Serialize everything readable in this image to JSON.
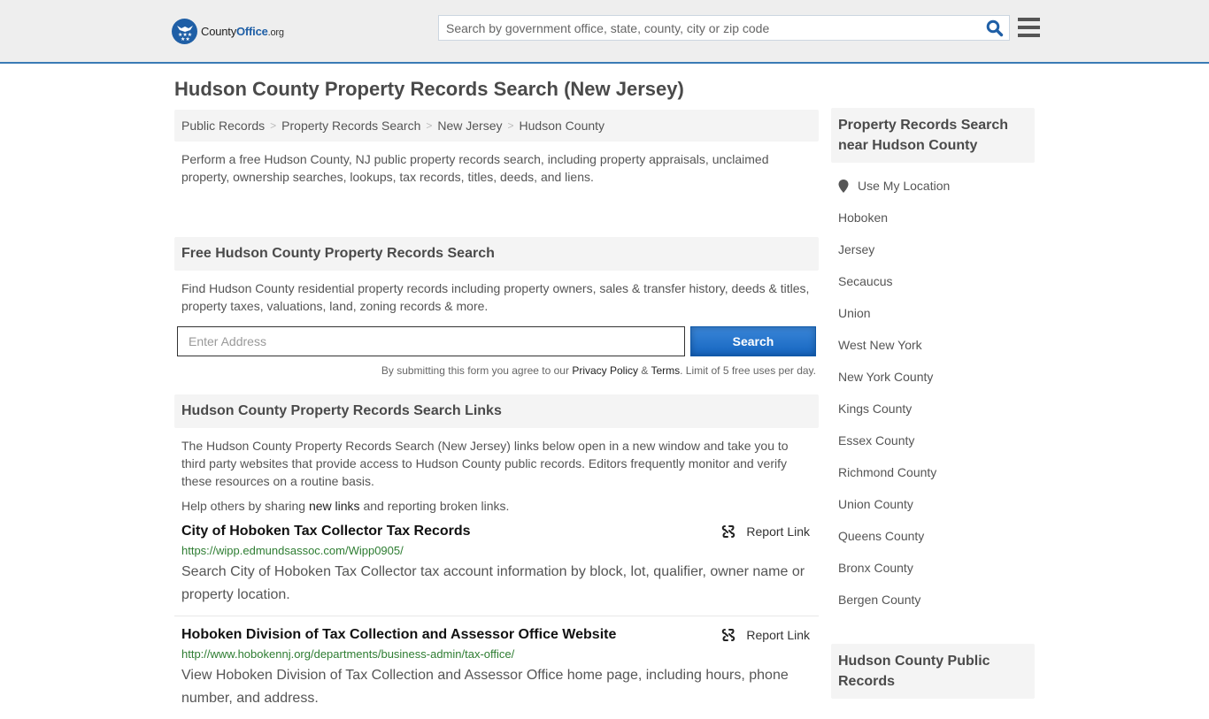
{
  "header": {
    "logo": {
      "name_part1": "County",
      "name_part2": "Office",
      "name_part3": ".org"
    },
    "search": {
      "placeholder": "Search by government office, state, county, city or zip code",
      "value": ""
    },
    "icons": {
      "search": "search-icon",
      "menu": "hamburger-menu-icon"
    }
  },
  "page": {
    "title": "Hudson County Property Records Search (New Jersey)",
    "breadcrumb": [
      {
        "label": "Public Records"
      },
      {
        "label": "Property Records Search"
      },
      {
        "label": "New Jersey"
      },
      {
        "label": "Hudson County"
      }
    ],
    "breadcrumb_separator": ">",
    "intro": "Perform a free Hudson County, NJ public property records search, including property appraisals, unclaimed property, ownership searches, lookups, tax records, titles, deeds, and liens."
  },
  "free_search": {
    "heading": "Free Hudson County Property Records Search",
    "description": "Find Hudson County residential property records including property owners, sales & transfer history, deeds & titles, property taxes, valuations, land, zoning records & more.",
    "address_input": {
      "placeholder": "Enter Address",
      "value": ""
    },
    "search_button": "Search",
    "terms": {
      "prefix": "By submitting this form you agree to our ",
      "privacy_label": "Privacy Policy",
      "amp": " & ",
      "terms_label": "Terms",
      "suffix": ". Limit of 5 free uses per day."
    }
  },
  "links_section": {
    "heading": "Hudson County Property Records Search Links",
    "description": "The Hudson County Property Records Search (New Jersey) links below open in a new window and take you to third party websites that provide access to Hudson County public records. Editors frequently monitor and verify these resources on a routine basis.",
    "help": {
      "prefix": "Help others by sharing ",
      "link": "new links",
      "suffix": " and reporting broken links."
    },
    "report_label": "Report Link",
    "items": [
      {
        "title": "City of Hoboken Tax Collector Tax Records",
        "url": "https://wipp.edmundsassoc.com/Wipp0905/",
        "description": "Search City of Hoboken Tax Collector tax account information by block, lot, qualifier, owner name or property location."
      },
      {
        "title": "Hoboken Division of Tax Collection and Assessor Office Website",
        "url": "http://www.hobokennj.org/departments/business-admin/tax-office/",
        "description": "View Hoboken Division of Tax Collection and Assessor Office home page, including hours, phone number, and address."
      }
    ]
  },
  "sidebar": {
    "heading": "Property Records Search near Hudson County",
    "use_location": "Use My Location",
    "nearby": [
      "Hoboken",
      "Jersey",
      "Secaucus",
      "Union",
      "West New York",
      "New York County",
      "Kings County",
      "Essex County",
      "Richmond County",
      "Union County",
      "Queens County",
      "Bronx County",
      "Bergen County"
    ],
    "heading2": "Hudson County Public Records"
  },
  "colors": {
    "brand_blue": "#1f5fa6",
    "header_border": "#3a7bb5",
    "button_blue": "#1565c0",
    "url_green": "#2e7d32",
    "panel_gray": "#f4f4f4"
  }
}
